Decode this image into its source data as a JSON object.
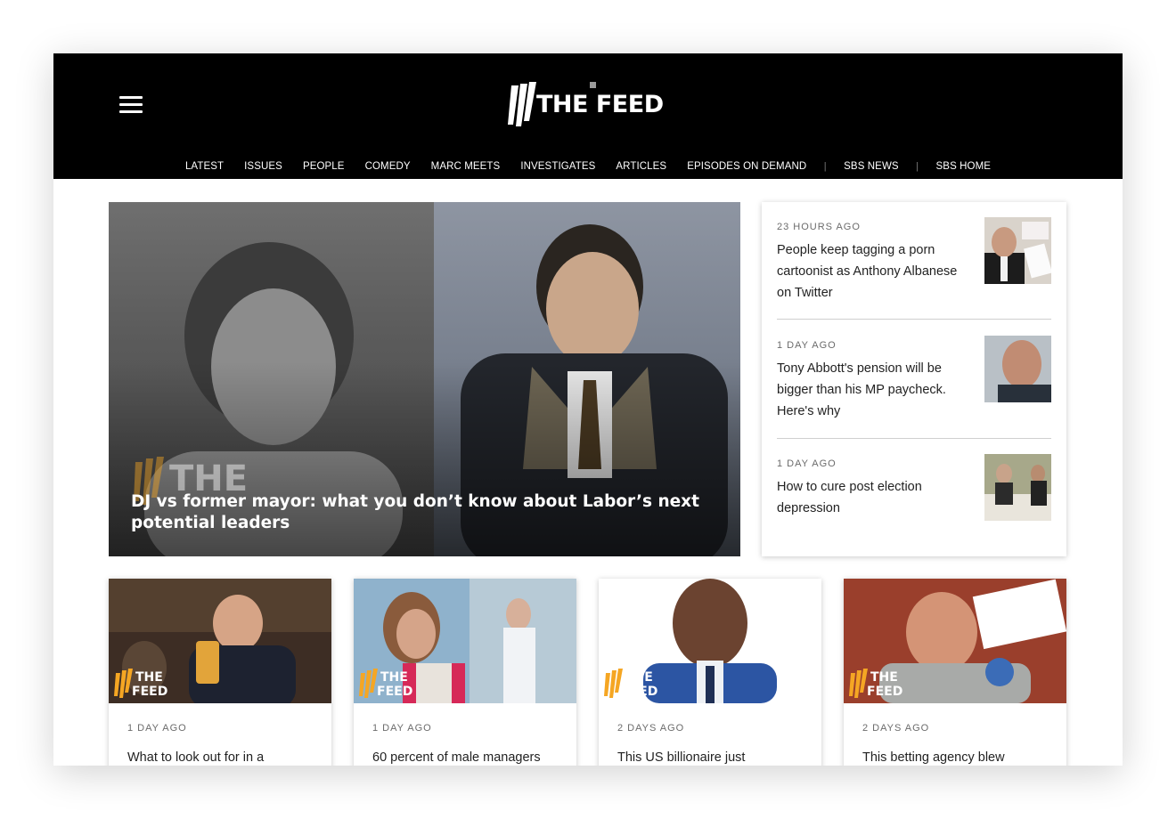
{
  "brand": {
    "name": "THE FEED"
  },
  "icons": {
    "menu": "hamburger-menu-icon",
    "logo": "sbs-feed-logo-icon"
  },
  "nav": {
    "items": [
      "LATEST",
      "ISSUES",
      "PEOPLE",
      "COMEDY",
      "MARC MEETS",
      "INVESTIGATES",
      "ARTICLES",
      "EPISODES ON DEMAND"
    ],
    "external": [
      "SBS NEWS",
      "SBS HOME"
    ],
    "separator": "|"
  },
  "hero": {
    "title": "DJ vs former mayor: what you don’t know about Labor’s next potential leaders"
  },
  "sidebar": {
    "items": [
      {
        "time": "23 HOURS AGO",
        "title": "People keep tagging a porn cartoonist as Anthony Albanese on Twitter"
      },
      {
        "time": "1 DAY AGO",
        "title": "Tony Abbott's pension will be bigger than his MP paycheck. Here's why"
      },
      {
        "time": "1 DAY AGO",
        "title": "How to cure post election depression"
      }
    ]
  },
  "cards": [
    {
      "time": "1 DAY AGO",
      "title": "What to look out for in a"
    },
    {
      "time": "1 DAY AGO",
      "title": "60 percent of male managers"
    },
    {
      "time": "2 DAYS AGO",
      "title": "This US billionaire just"
    },
    {
      "time": "2 DAYS AGO",
      "title": "This betting agency blew"
    }
  ],
  "watermark": {
    "line1": "THE",
    "line2": "FEED"
  },
  "colors": {
    "header_bg": "#000000",
    "text": "#222222",
    "meta": "#6b6b6b",
    "accent": "#f5a623"
  }
}
